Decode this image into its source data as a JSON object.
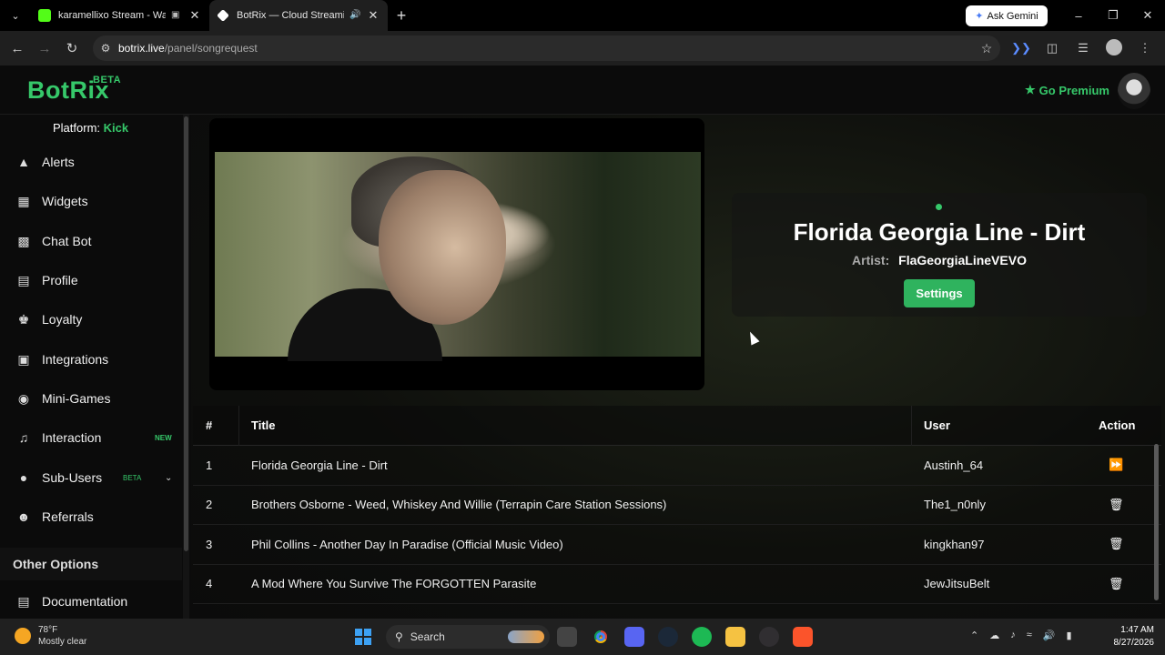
{
  "browser": {
    "tabs": [
      {
        "title": "karamellixo Stream - Watch",
        "favicon_color": "#53fc18"
      },
      {
        "title": "BotRix — Cloud Streaming |",
        "favicon_color": "#ffffff"
      }
    ],
    "ask_gemini": "Ask Gemini",
    "url_domain": "botrix.live",
    "url_path": "/panel/songrequest"
  },
  "app": {
    "logo": "BotRix",
    "logo_badge": "BETA",
    "go_premium": "Go Premium",
    "brand_color": "#36c86a"
  },
  "sidebar": {
    "platform_label": "Platform:",
    "platform_value": "Kick",
    "items": [
      {
        "label": "Alerts",
        "icon": "warning-icon"
      },
      {
        "label": "Widgets",
        "icon": "grid-icon"
      },
      {
        "label": "Chat Bot",
        "icon": "robot-icon"
      },
      {
        "label": "Profile",
        "icon": "id-card-icon"
      },
      {
        "label": "Loyalty",
        "icon": "trophy-icon"
      },
      {
        "label": "Integrations",
        "icon": "puzzle-icon"
      },
      {
        "label": "Mini-Games",
        "icon": "gamepad-icon"
      },
      {
        "label": "Interaction",
        "icon": "music-icon",
        "tag": "NEW"
      },
      {
        "label": "Sub-Users",
        "icon": "users-icon",
        "tag": "BETA"
      },
      {
        "label": "Referrals",
        "icon": "user-group-icon"
      }
    ],
    "other_options": "Other Options",
    "documentation": "Documentation"
  },
  "now_playing": {
    "title": "Florida Georgia Line - Dirt",
    "artist_label": "Artist:",
    "artist": "FlaGeorgiaLineVEVO",
    "settings_label": "Settings"
  },
  "queue": {
    "headers": {
      "num": "#",
      "title": "Title",
      "user": "User",
      "action": "Action"
    },
    "rows": [
      {
        "num": "1",
        "title": "Florida Georgia Line - Dirt",
        "user": "Austinh_64",
        "action": "skip-icon"
      },
      {
        "num": "2",
        "title": "Brothers Osborne - Weed, Whiskey And Willie (Terrapin Care Station Sessions)",
        "user": "The1_n0nly",
        "action": "trash-icon"
      },
      {
        "num": "3",
        "title": "Phil Collins - Another Day In Paradise (Official Music Video)",
        "user": "kingkhan97",
        "action": "trash-icon"
      },
      {
        "num": "4",
        "title": "A Mod Where You Survive The FORGOTTEN Parasite",
        "user": "JewJitsuBelt",
        "action": "trash-icon"
      }
    ]
  },
  "taskbar": {
    "temp": "78°F",
    "weather": "Mostly clear",
    "search": "Search",
    "time": "1:47 AM",
    "date": "8/27/2026"
  }
}
